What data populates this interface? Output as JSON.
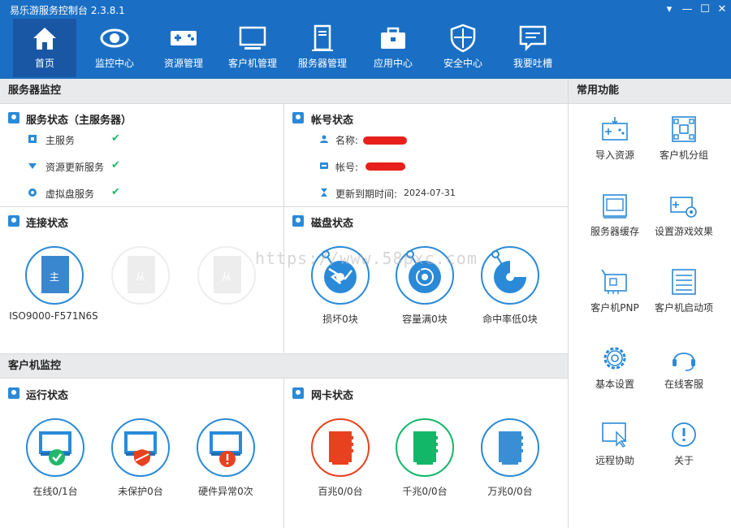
{
  "window": {
    "title": "易乐游服务控制台 2.3.8.1",
    "controls": [
      "▾",
      "—",
      "☐",
      "✕"
    ]
  },
  "nav": [
    {
      "label": "首页",
      "icon": "home-icon"
    },
    {
      "label": "监控中心",
      "icon": "eye-icon"
    },
    {
      "label": "资源管理",
      "icon": "gamepad-icon"
    },
    {
      "label": "客户机管理",
      "icon": "monitor-icon"
    },
    {
      "label": "服务器管理",
      "icon": "server-icon"
    },
    {
      "label": "应用中心",
      "icon": "toolbox-icon"
    },
    {
      "label": "安全中心",
      "icon": "shield-icon"
    },
    {
      "label": "我要吐槽",
      "icon": "feedback-icon"
    }
  ],
  "server_monitor": {
    "header": "服务器监控",
    "service_status": {
      "title": "服务状态（主服务器）",
      "items": [
        {
          "label": "主服务",
          "ok": "✔"
        },
        {
          "label": "资源更新服务",
          "ok": "✔"
        },
        {
          "label": "虚拟盘服务",
          "ok": "✔"
        }
      ]
    },
    "account_status": {
      "title": "帐号状态",
      "name_label": "名称:",
      "account_label": "帐号:",
      "expiry_label": "更新到期时间:",
      "expiry_value": "2024-07-31"
    },
    "connection_status": {
      "title": "连接状态",
      "master_label": "主",
      "slave_label": "从",
      "server_name": "ISO9000-F571N6S"
    },
    "disk_status": {
      "title": "磁盘状态",
      "items": [
        "损坏0块",
        "容量满0块",
        "命中率低0块"
      ]
    }
  },
  "client_monitor": {
    "header": "客户机监控",
    "run_status": {
      "title": "运行状态",
      "items": [
        "在线0/1台",
        "未保护0台",
        "硬件异常0次"
      ]
    },
    "nic_status": {
      "title": "网卡状态",
      "items": [
        "百兆0/0台",
        "千兆0/0台",
        "万兆0/0台"
      ]
    }
  },
  "common_functions": {
    "header": "常用功能",
    "items": [
      {
        "label": "导入资源",
        "icon": "import-resource-icon"
      },
      {
        "label": "客户机分组",
        "icon": "client-group-icon"
      },
      {
        "label": "服务器缓存",
        "icon": "server-cache-icon"
      },
      {
        "label": "设置游戏效果",
        "icon": "game-settings-icon"
      },
      {
        "label": "客户机PNP",
        "icon": "pnp-icon"
      },
      {
        "label": "客户机启动项",
        "icon": "startup-items-icon"
      },
      {
        "label": "基本设置",
        "icon": "gear-icon"
      },
      {
        "label": "在线客服",
        "icon": "headset-icon"
      },
      {
        "label": "远程协助",
        "icon": "remote-assist-icon"
      },
      {
        "label": "关于",
        "icon": "info-icon"
      }
    ]
  },
  "watermark": "https://www.58pxc.com",
  "colors": {
    "brand": "#1a6fc4",
    "ok": "#21b86b",
    "accent": "#2a8ad8",
    "red": "#e8411f",
    "green": "#12b768"
  }
}
